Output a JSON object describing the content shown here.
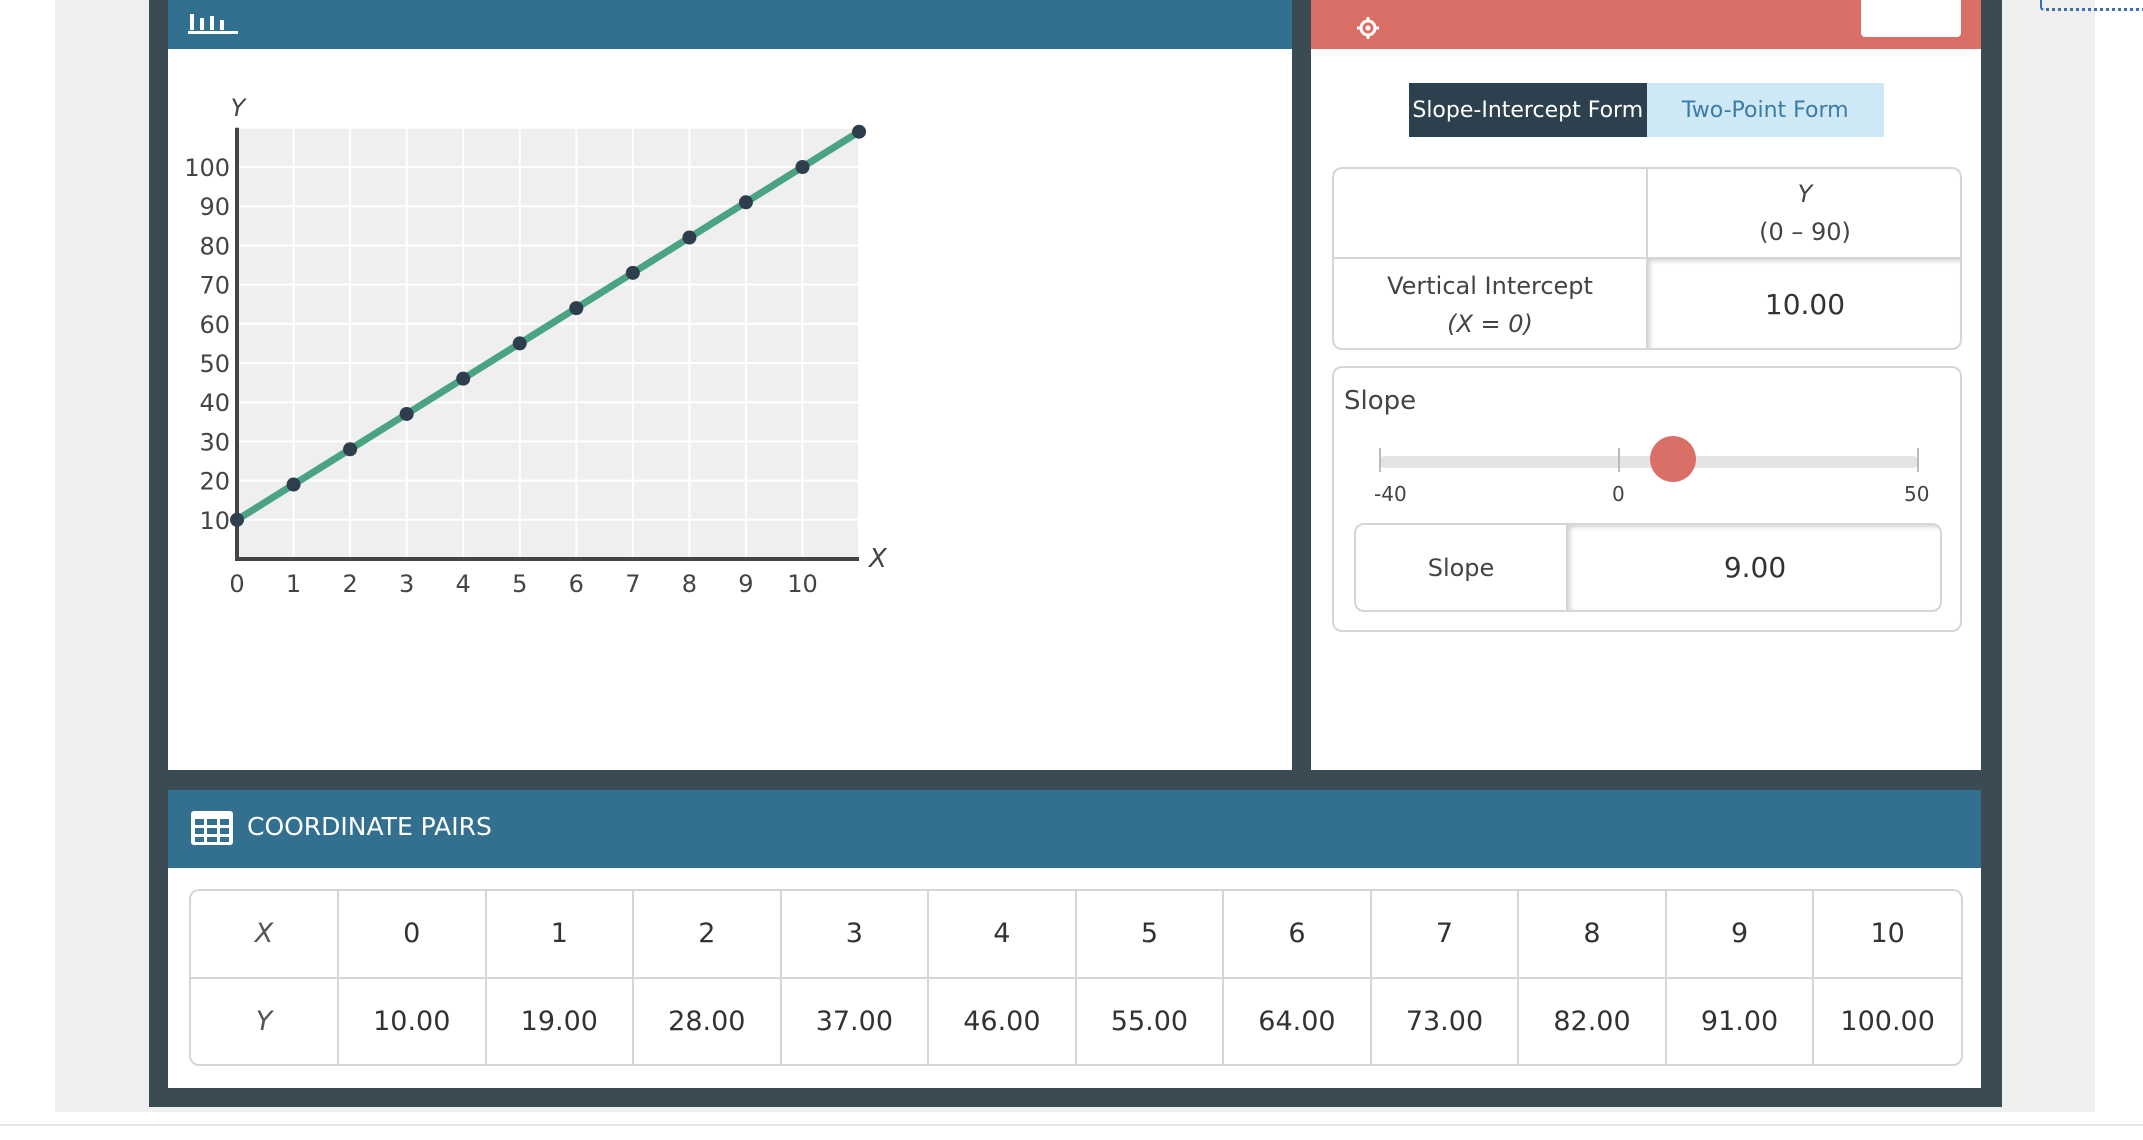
{
  "colors": {
    "graph_header": "#336f8f",
    "control_header": "#d96f66",
    "line": "#4aa383",
    "point": "#2f3e4d",
    "slider_thumb": "#d96f66"
  },
  "graph": {
    "header_icon": "bar-chart-icon",
    "y_axis_label": "Y",
    "x_axis_label": "X"
  },
  "chart_data": {
    "type": "line",
    "x": [
      0,
      1,
      2,
      3,
      4,
      5,
      6,
      7,
      8,
      9,
      10,
      11
    ],
    "y": [
      10,
      19,
      28,
      37,
      46,
      55,
      64,
      73,
      82,
      91,
      100,
      109
    ],
    "xlabel": "X",
    "ylabel": "Y",
    "xlim": [
      0,
      11
    ],
    "ylim": [
      0,
      110
    ],
    "x_ticks": [
      "0",
      "1",
      "2",
      "3",
      "4",
      "5",
      "6",
      "7",
      "8",
      "9",
      "10"
    ],
    "y_ticks": [
      "10",
      "20",
      "30",
      "40",
      "50",
      "60",
      "70",
      "80",
      "90",
      "100"
    ],
    "grid": true
  },
  "controls": {
    "header_icon": "gear-icon",
    "tabs": [
      {
        "label": "Slope-Intercept Form",
        "active": true
      },
      {
        "label": "Two-Point Form",
        "active": false
      }
    ],
    "intercept": {
      "column_header": "Y",
      "column_range": "(0 – 90)",
      "row_label": "Vertical Intercept",
      "row_condition": "(X = 0)",
      "value": "10.00"
    },
    "slope": {
      "title": "Slope",
      "min_label": "-40",
      "mid_label": "0",
      "max_label": "50",
      "input_label": "Slope",
      "value": "9.00"
    }
  },
  "coordinate_pairs": {
    "title": "COORDINATE PAIRS",
    "icon": "table-grid-icon",
    "x_label": "X",
    "y_label": "Y",
    "x_values": [
      "0",
      "1",
      "2",
      "3",
      "4",
      "5",
      "6",
      "7",
      "8",
      "9",
      "10"
    ],
    "y_values": [
      "10.00",
      "19.00",
      "28.00",
      "37.00",
      "46.00",
      "55.00",
      "64.00",
      "73.00",
      "82.00",
      "91.00",
      "100.00"
    ]
  }
}
